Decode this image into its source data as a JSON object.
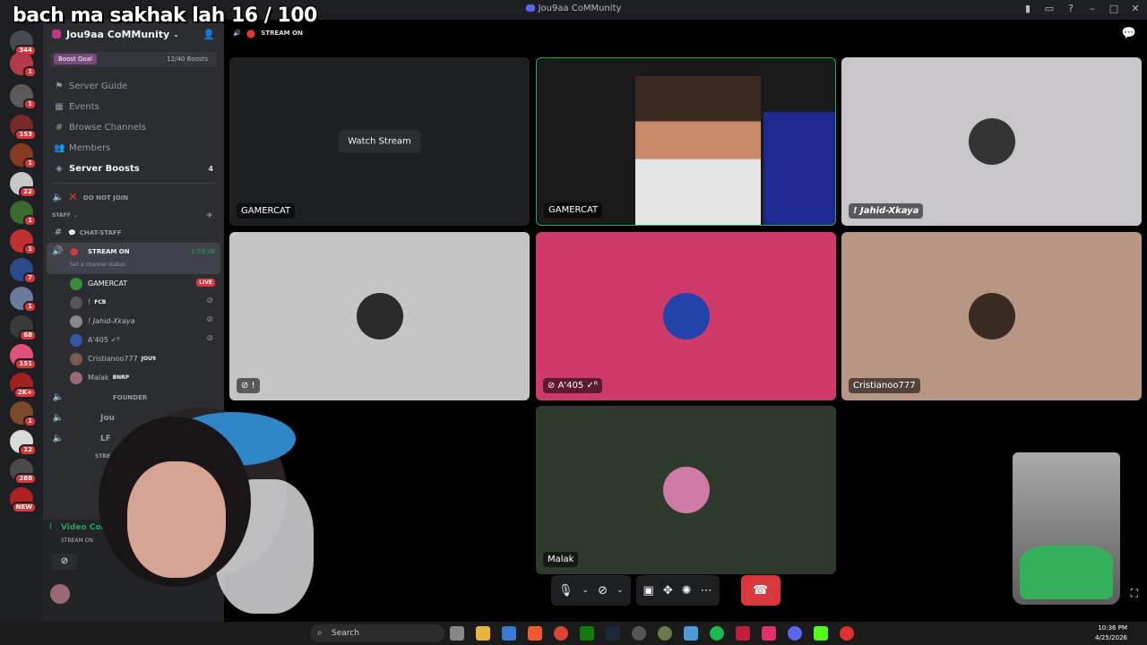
{
  "overlay": {
    "text": "bach ma sakhak lah 16 / 100"
  },
  "window": {
    "title": "Jou9aa CoMMunity"
  },
  "server_rail": {
    "badges": [
      "344",
      "1",
      "1",
      "153",
      "1",
      "22",
      "1",
      "1",
      "7",
      "1",
      "68",
      "151",
      "2K+",
      "1",
      "12",
      "288",
      "NEW"
    ]
  },
  "guild": {
    "name": "Jou9aa CoMMunity",
    "boost_goal_label": "Boost Goal",
    "boost_count": "12/40 Boosts",
    "nav": [
      {
        "label": "Server Guide"
      },
      {
        "label": "Events"
      },
      {
        "label": "Browse Channels"
      },
      {
        "label": "Members"
      },
      {
        "label": "Server Boosts",
        "count": "4"
      }
    ]
  },
  "channels": {
    "do_not_join": "DO NOT JOIN",
    "staff_category": "STAFF",
    "chat_staff": "CHAT-STAFF",
    "stream_on": {
      "name": "STREAM ON",
      "time": "1:59:38",
      "status": "Set a channel status"
    },
    "founder": "FOUNDER",
    "jou_partial": "Jou",
    "lf_partial": "LF",
    "strea_partial": "STREA"
  },
  "members": [
    {
      "name": "GAMERCAT",
      "live": "LIVE",
      "color": "#3b8a3b"
    },
    {
      "name": "! ",
      "tag": "FCB",
      "color": "#555"
    },
    {
      "name": "! Jahid-Xkaya",
      "color": "#888"
    },
    {
      "name": "A'405 ✓ᴿ",
      "color": "#3355aa"
    },
    {
      "name": "Cristianoo777",
      "tag": "JOU9",
      "color": "#7a5a48"
    },
    {
      "name": "Malak",
      "tag": "BNRP",
      "color": "#9a6a74"
    }
  ],
  "voice": {
    "connected": "Video Connec",
    "sub": "STREAM ON"
  },
  "stage": {
    "channel_label": "STREAM ON",
    "tiles": [
      {
        "name": "GAMERCAT",
        "bg": "#1e1f22",
        "watch": "Watch Stream"
      },
      {
        "name": "GAMERCAT",
        "bg": "#111"
      },
      {
        "name": "! Jahid-Xkaya",
        "bg": "#c8c6ca"
      },
      {
        "name": "!",
        "bg": "#c5c5c5"
      },
      {
        "name": "A'405 ✓ᴿ",
        "bg": "#d03a6a"
      },
      {
        "name": "Cristianoo777",
        "bg": "#b89684"
      },
      {
        "name": "Malak",
        "bg": "#2e3a2c"
      }
    ]
  },
  "taskbar": {
    "search": "Search",
    "time": "10:36 PM",
    "date": "4/25/2026"
  }
}
